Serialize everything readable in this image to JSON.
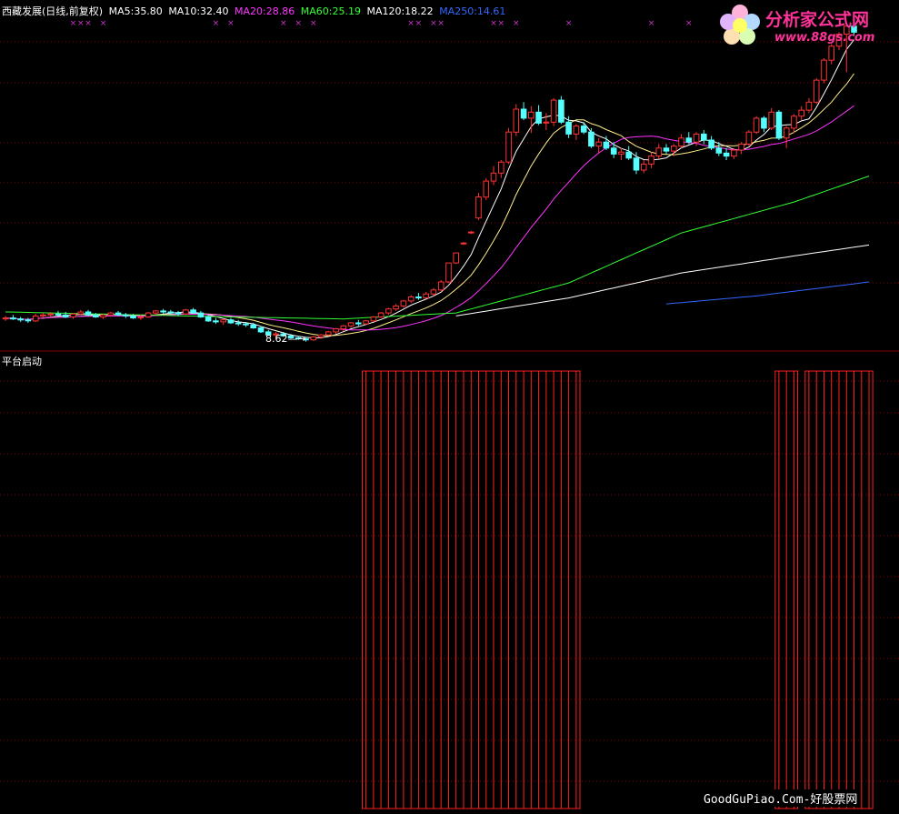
{
  "header": {
    "title": "西藏发展(日线,前复权)",
    "ma_labels": [
      {
        "text": "MA5:35.80",
        "color": "#ffffff"
      },
      {
        "text": "MA10:32.40",
        "color": "#ffffff"
      },
      {
        "text": "MA20:28.86",
        "color": "#ff33ff"
      },
      {
        "text": "MA60:25.19",
        "color": "#33ff33"
      },
      {
        "text": "MA120:18.22",
        "color": "#ffffff"
      },
      {
        "text": "MA250:14.61",
        "color": "#3366ff"
      }
    ]
  },
  "annotations": {
    "low_price": "8.62",
    "indicator_name": "平台启动"
  },
  "watermark": {
    "logo_title": "分析家公式网",
    "logo_url": "www.88gs.com",
    "footer": "GoodGuPiao.Com-好股票网"
  },
  "colors": {
    "up": "#ff3333",
    "down": "#55ffff",
    "grid": "#8a0000",
    "signal": "#ff2020"
  },
  "chart_data": [
    {
      "type": "candlestick",
      "title": "西藏发展(日线,前复权)",
      "ylim": [
        7.5,
        41
      ],
      "bars": [
        [
          10.9,
          11.2,
          10.7,
          11.0
        ],
        [
          11.0,
          11.3,
          10.8,
          10.9
        ],
        [
          10.9,
          11.1,
          10.6,
          10.8
        ],
        [
          10.8,
          11.0,
          10.5,
          10.7
        ],
        [
          10.7,
          11.4,
          10.6,
          11.2
        ],
        [
          11.2,
          11.5,
          11.0,
          11.3
        ],
        [
          11.3,
          11.6,
          11.1,
          11.4
        ],
        [
          11.4,
          11.7,
          11.2,
          11.3
        ],
        [
          11.3,
          11.6,
          11.0,
          11.1
        ],
        [
          11.1,
          11.5,
          10.9,
          11.4
        ],
        [
          11.4,
          11.8,
          11.3,
          11.6
        ],
        [
          11.6,
          11.8,
          11.2,
          11.3
        ],
        [
          11.3,
          11.5,
          11.0,
          11.1
        ],
        [
          11.1,
          11.4,
          10.9,
          11.3
        ],
        [
          11.3,
          11.6,
          11.1,
          11.5
        ],
        [
          11.5,
          11.7,
          11.2,
          11.3
        ],
        [
          11.3,
          11.5,
          11.0,
          11.2
        ],
        [
          11.2,
          11.4,
          10.9,
          11.0
        ],
        [
          11.0,
          11.3,
          10.8,
          11.1
        ],
        [
          11.1,
          11.6,
          11.0,
          11.5
        ],
        [
          11.5,
          11.8,
          11.3,
          11.7
        ],
        [
          11.7,
          11.9,
          11.4,
          11.6
        ],
        [
          11.6,
          11.8,
          11.3,
          11.5
        ],
        [
          11.5,
          11.7,
          11.2,
          11.4
        ],
        [
          11.4,
          11.9,
          11.3,
          11.8
        ],
        [
          11.8,
          12.0,
          11.4,
          11.5
        ],
        [
          11.5,
          11.7,
          11.0,
          11.1
        ],
        [
          11.1,
          11.3,
          10.6,
          10.7
        ],
        [
          10.7,
          11.0,
          10.4,
          10.6
        ],
        [
          10.6,
          10.9,
          10.3,
          10.8
        ],
        [
          10.8,
          11.0,
          10.4,
          10.5
        ],
        [
          10.5,
          10.8,
          10.2,
          10.4
        ],
        [
          10.4,
          10.6,
          10.1,
          10.3
        ],
        [
          10.3,
          10.5,
          9.9,
          10.0
        ],
        [
          10.0,
          10.2,
          9.5,
          9.6
        ],
        [
          9.6,
          9.8,
          9.2,
          9.3
        ],
        [
          9.3,
          9.6,
          9.0,
          9.4
        ],
        [
          9.4,
          9.6,
          9.1,
          9.2
        ],
        [
          9.2,
          9.4,
          8.9,
          9.0
        ],
        [
          9.0,
          9.2,
          8.8,
          8.9
        ],
        [
          8.9,
          9.1,
          8.62,
          8.8
        ],
        [
          8.8,
          9.2,
          8.7,
          9.1
        ],
        [
          9.1,
          9.4,
          8.9,
          9.3
        ],
        [
          9.3,
          9.7,
          9.2,
          9.6
        ],
        [
          9.6,
          10.0,
          9.4,
          9.9
        ],
        [
          9.9,
          10.3,
          9.7,
          10.2
        ],
        [
          10.2,
          10.6,
          10.0,
          10.5
        ],
        [
          10.5,
          10.8,
          10.2,
          10.4
        ],
        [
          10.4,
          10.8,
          10.3,
          10.7
        ],
        [
          10.7,
          11.2,
          10.6,
          11.1
        ],
        [
          11.1,
          11.6,
          11.0,
          11.5
        ],
        [
          11.5,
          12.0,
          11.3,
          11.9
        ],
        [
          11.9,
          12.4,
          11.7,
          12.2
        ],
        [
          12.2,
          12.8,
          12.0,
          12.7
        ],
        [
          12.7,
          13.3,
          12.5,
          13.1
        ],
        [
          13.1,
          13.5,
          12.8,
          13.0
        ],
        [
          13.0,
          13.6,
          12.9,
          13.4
        ],
        [
          13.4,
          14.0,
          13.2,
          13.8
        ],
        [
          13.8,
          14.8,
          13.6,
          14.6
        ],
        [
          14.6,
          16.5,
          14.5,
          16.5
        ],
        [
          16.5,
          17.5,
          16.4,
          17.5
        ],
        [
          18.5,
          18.6,
          18.3,
          18.5
        ],
        [
          19.6,
          19.7,
          19.4,
          19.6
        ],
        [
          21.0,
          23.5,
          20.8,
          23.1
        ],
        [
          23.1,
          25.0,
          22.8,
          24.7
        ],
        [
          24.7,
          26.2,
          24.3,
          25.5
        ],
        [
          25.5,
          26.8,
          25.0,
          26.6
        ],
        [
          26.6,
          30.0,
          26.4,
          29.6
        ],
        [
          29.6,
          32.4,
          29.2,
          31.9
        ],
        [
          31.9,
          32.6,
          30.8,
          31.0
        ],
        [
          31.0,
          32.2,
          29.5,
          31.6
        ],
        [
          31.6,
          32.3,
          30.3,
          30.5
        ],
        [
          30.5,
          31.5,
          29.8,
          30.6
        ],
        [
          30.6,
          33.0,
          30.2,
          32.8
        ],
        [
          32.8,
          33.2,
          30.4,
          30.6
        ],
        [
          30.6,
          31.2,
          29.0,
          29.4
        ],
        [
          29.4,
          30.4,
          28.8,
          30.2
        ],
        [
          30.2,
          30.6,
          29.4,
          29.6
        ],
        [
          29.6,
          30.0,
          28.0,
          28.2
        ],
        [
          28.2,
          29.0,
          27.5,
          28.6
        ],
        [
          28.6,
          29.2,
          27.8,
          28.0
        ],
        [
          28.0,
          28.6,
          27.0,
          27.4
        ],
        [
          27.4,
          28.0,
          26.8,
          27.6
        ],
        [
          27.6,
          28.2,
          26.8,
          27.0
        ],
        [
          27.0,
          27.6,
          25.4,
          25.8
        ],
        [
          25.8,
          26.8,
          25.5,
          26.4
        ],
        [
          26.4,
          27.6,
          26.0,
          27.2
        ],
        [
          27.2,
          28.4,
          26.9,
          28.0
        ],
        [
          28.0,
          28.4,
          27.4,
          27.7
        ],
        [
          27.7,
          28.4,
          27.2,
          28.2
        ],
        [
          28.2,
          29.4,
          28.0,
          29.0
        ],
        [
          29.0,
          29.6,
          28.4,
          28.6
        ],
        [
          28.6,
          29.6,
          28.2,
          29.4
        ],
        [
          29.4,
          29.8,
          28.4,
          28.8
        ],
        [
          28.8,
          29.2,
          27.8,
          28.0
        ],
        [
          28.0,
          28.6,
          27.2,
          27.5
        ],
        [
          27.5,
          28.0,
          26.8,
          27.2
        ],
        [
          27.2,
          28.0,
          26.9,
          27.8
        ],
        [
          27.8,
          28.6,
          27.4,
          28.4
        ],
        [
          28.4,
          29.8,
          28.2,
          29.6
        ],
        [
          29.6,
          31.2,
          29.4,
          31.0
        ],
        [
          31.0,
          31.2,
          29.6,
          30.0
        ],
        [
          30.0,
          32.0,
          29.8,
          31.6
        ],
        [
          31.6,
          31.8,
          28.8,
          29.0
        ],
        [
          29.0,
          30.2,
          28.0,
          30.0
        ],
        [
          30.0,
          31.4,
          29.5,
          31.2
        ],
        [
          31.2,
          32.2,
          30.8,
          31.8
        ],
        [
          31.8,
          33.0,
          31.5,
          32.6
        ],
        [
          32.6,
          35.0,
          32.4,
          34.8
        ],
        [
          34.8,
          37.0,
          34.5,
          36.8
        ],
        [
          36.8,
          38.4,
          36.4,
          38.2
        ],
        [
          38.2,
          39.6,
          37.8,
          39.4
        ],
        [
          39.4,
          40.6,
          35.6,
          40.2
        ],
        [
          40.2,
          40.8,
          39.2,
          39.6
        ]
      ],
      "ma": [
        {
          "name": "MA5",
          "color": "#ffffff",
          "period": 5
        },
        {
          "name": "MA10",
          "color": "#ffee88",
          "period": 10
        },
        {
          "name": "MA20",
          "color": "#ff33ff",
          "period": 20
        },
        {
          "name": "MA60",
          "color": "#33ff33",
          "period": 60
        },
        {
          "name": "MA120",
          "color": "#ffffff",
          "period": 120
        },
        {
          "name": "MA250",
          "color": "#3366ff",
          "period": 250
        }
      ],
      "ma_long_segments": {
        "MA60": [
          [
            0,
            11.6
          ],
          [
            30,
            11.1
          ],
          [
            45,
            10.9
          ],
          [
            60,
            11.5
          ],
          [
            75,
            14.5
          ],
          [
            90,
            19.5
          ],
          [
            105,
            22.6
          ],
          [
            115,
            25.2
          ]
        ],
        "MA120": [
          [
            60,
            11.2
          ],
          [
            75,
            13.0
          ],
          [
            90,
            15.5
          ],
          [
            105,
            17.2
          ],
          [
            115,
            18.3
          ]
        ],
        "MA250": [
          [
            88,
            12.4
          ],
          [
            100,
            13.2
          ],
          [
            115,
            14.6
          ]
        ]
      }
    },
    {
      "type": "bar",
      "name": "平台启动",
      "signal_ranges": [
        [
          48,
          76
        ],
        [
          103,
          105
        ],
        [
          107,
          115
        ]
      ],
      "values": "1 on signal days, 0 otherwise"
    }
  ]
}
